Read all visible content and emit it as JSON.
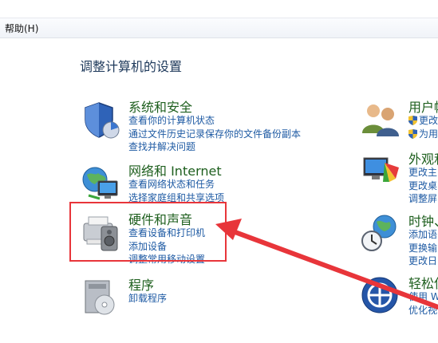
{
  "menu": {
    "help_label": "帮助(H)"
  },
  "page_title": "调整计算机的设置",
  "left_categories": [
    {
      "title": "系统和安全",
      "links": [
        "查看你的计算机状态",
        "通过文件历史记录保存你的文件备份副本",
        "查找并解决问题"
      ]
    },
    {
      "title": "网络和 Internet",
      "links": [
        "查看网络状态和任务",
        "选择家庭组和共享选项"
      ]
    },
    {
      "title": "硬件和声音",
      "links": [
        "查看设备和打印机",
        "添加设备",
        "调整常用移动设置"
      ]
    },
    {
      "title": "程序",
      "links": [
        "卸载程序"
      ]
    }
  ],
  "right_categories": [
    {
      "title": "用户帐",
      "links": [
        "更改",
        "为用"
      ]
    },
    {
      "title": "外观和",
      "links": [
        "更改主",
        "更改桌",
        "调整屏"
      ]
    },
    {
      "title": "时钟、",
      "links": [
        "添加语",
        "更换输",
        "更改日"
      ]
    },
    {
      "title": "轻松使",
      "links": [
        "使用 W",
        "优化视"
      ]
    }
  ],
  "colors": {
    "title_green": "#1e5f1e",
    "link_blue": "#1e5aa3",
    "annotation_red": "#e8353a"
  }
}
